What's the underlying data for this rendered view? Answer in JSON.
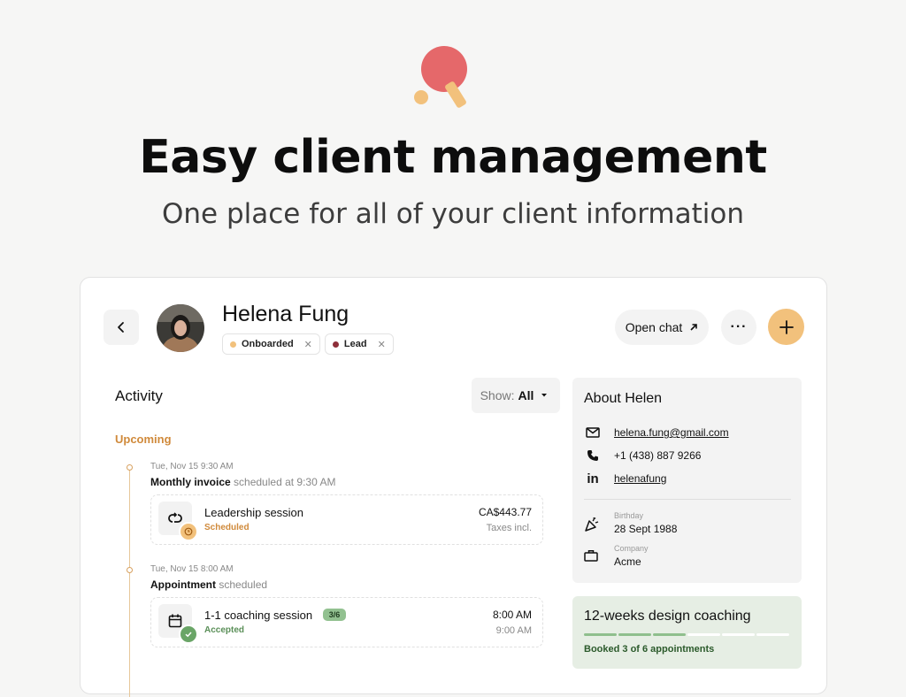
{
  "hero": {
    "title": "Easy client management",
    "subtitle": "One place for all of your client information",
    "logo_icon": "ping-pong-paddle-icon"
  },
  "client": {
    "name": "Helena Fung",
    "tags": [
      {
        "label": "Onboarded",
        "color": "#f2c17c"
      },
      {
        "label": "Lead",
        "color": "#8e2f3a"
      }
    ]
  },
  "header_actions": {
    "open_chat_label": "Open chat",
    "more_label": "···"
  },
  "activity": {
    "title": "Activity",
    "show_label": "Show:",
    "show_value": "All",
    "section_label": "Upcoming",
    "events": [
      {
        "time": "Tue, Nov 15 9:30 AM",
        "desc_strong": "Monthly invoice",
        "desc_rest": "scheduled at 9:30 AM",
        "title": "Leadership session",
        "status": "Scheduled",
        "status_color": "#d08a3b",
        "right_primary": "CA$443.77",
        "right_secondary": "Taxes incl."
      },
      {
        "time": "Tue, Nov 15 8:00 AM",
        "desc_strong": "Appointment",
        "desc_rest": "scheduled",
        "title": "1-1 coaching session",
        "progress": "3/6",
        "status": "Accepted",
        "status_color": "#5a8f58",
        "right_primary": "8:00 AM",
        "right_secondary": "9:00 AM"
      }
    ]
  },
  "about": {
    "title": "About Helen",
    "email": "helena.fung@gmail.com",
    "phone": "+1 (438) 887 9266",
    "linkedin": "helenafung",
    "birthday_label": "Birthday",
    "birthday": "28 Sept 1988",
    "company_label": "Company",
    "company": "Acme"
  },
  "program": {
    "title": "12-weeks design coaching",
    "booked_text": "Booked 3 of 6 appointments",
    "booked": 3,
    "total": 6
  },
  "colors": {
    "accent": "#f2c17c",
    "logo_red": "#e5686a",
    "upcoming": "#d08a3b",
    "success": "#8fbf8d"
  }
}
